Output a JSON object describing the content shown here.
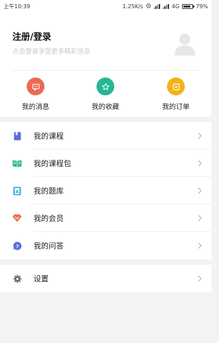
{
  "status_bar": {
    "time": "上午10:39",
    "speed": "1.25K/s",
    "network": "4G",
    "battery": "79%",
    "battery_level": 0.79
  },
  "profile": {
    "login_label": "注册/登录",
    "login_hint": "点击登录享受更多精彩信息"
  },
  "quick_actions": [
    {
      "label": "我的消息",
      "icon": "message-icon",
      "color": "#ec6a53"
    },
    {
      "label": "我的收藏",
      "icon": "star-icon",
      "color": "#27b597"
    },
    {
      "label": "我的订单",
      "icon": "order-icon",
      "color": "#f2b31a"
    }
  ],
  "menu": [
    {
      "label": "我的课程",
      "icon": "book-icon",
      "color": "#5c6fd9"
    },
    {
      "label": "我的课程包",
      "icon": "course-pack-icon",
      "color": "#2db89a"
    },
    {
      "label": "我的题库",
      "icon": "question-bank-icon",
      "color": "#2aa4e2"
    },
    {
      "label": "我的会员",
      "icon": "membership-icon",
      "color": "#ef6b55"
    },
    {
      "label": "我的问答",
      "icon": "qa-icon",
      "color": "#5c6fd9"
    }
  ],
  "settings": {
    "label": "设置",
    "icon": "gear-icon",
    "color": "#666666"
  }
}
